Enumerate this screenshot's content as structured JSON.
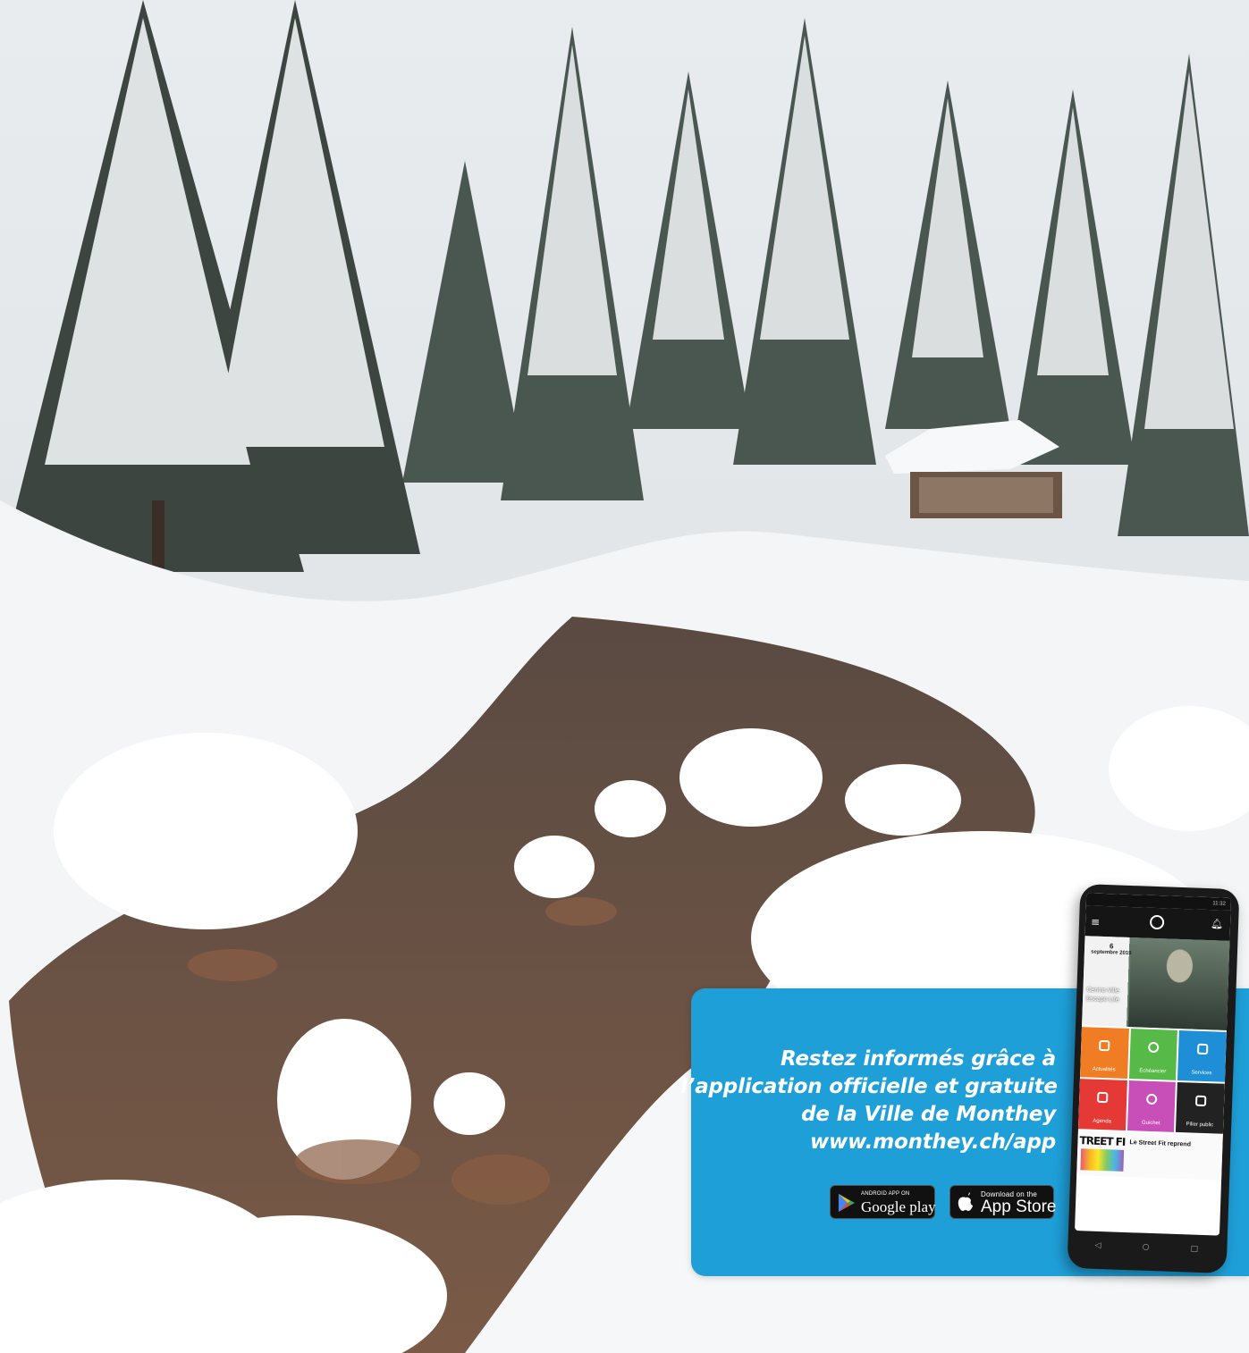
{
  "promo": {
    "lines": [
      "Restez informés grâce à",
      "l’application officielle et gratuite",
      "de la Ville de Monthey",
      "www.monthey.ch/app"
    ]
  },
  "stores": {
    "google": {
      "small": "ANDROID APP ON",
      "big": "Google play"
    },
    "apple": {
      "small": "Download on the",
      "big": "App Store"
    }
  },
  "phone": {
    "status": "11:32",
    "date_day": "6",
    "date_month": "septembre 2019",
    "event_line1": "Centre-Ville",
    "event_line2": "Escape Life",
    "tiles": [
      {
        "label": "Actualités",
        "color": "#f07c24"
      },
      {
        "label": "Echéancier",
        "color": "#57b947"
      },
      {
        "label": "Services",
        "color": "#1e8fd6"
      },
      {
        "label": "Agenda",
        "color": "#e53935"
      },
      {
        "label": "Guichet",
        "color": "#c84fb7"
      },
      {
        "label": "Pilier public",
        "color": "#222222"
      }
    ],
    "news_logo": "TREET FI",
    "news_title": "Le Street Fit reprend"
  },
  "colors": {
    "panel": "#1f9fd8"
  }
}
